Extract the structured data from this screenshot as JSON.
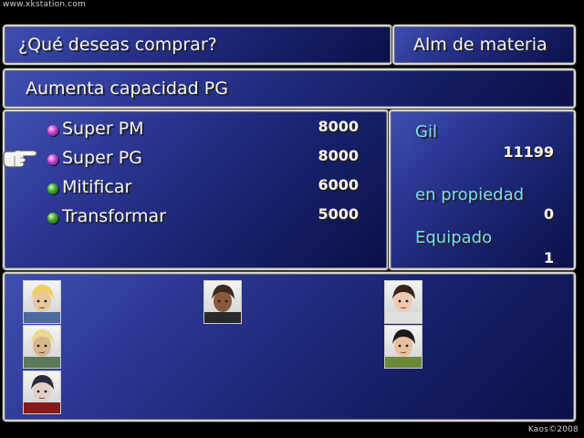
{
  "watermarks": {
    "top": "www.xkstation.com",
    "bottom": "Kaos©2008"
  },
  "header": {
    "prompt": "¿Qué deseas comprar?",
    "shop_name": "Alm de materia"
  },
  "description": "Aumenta capacidad PG",
  "items": [
    {
      "name": "Super PM",
      "price": "8000",
      "orb_color": "purple"
    },
    {
      "name": "Super PG",
      "price": "8000",
      "orb_color": "purple"
    },
    {
      "name": "Mitificar",
      "price": "6000",
      "orb_color": "green"
    },
    {
      "name": "Transformar",
      "price": "5000",
      "orb_color": "green"
    }
  ],
  "selected_index": 1,
  "cursor_icon": "pointing-hand-icon",
  "status": {
    "gil_label": "Gil",
    "gil_value": "11199",
    "owned_label": "en propiedad",
    "owned_value": "0",
    "equipped_label": "Equipado",
    "equipped_value": "1"
  },
  "party": [
    {
      "name": "cloud-portrait"
    },
    {
      "name": "cid-portrait"
    },
    {
      "name": "vincent-portrait"
    },
    {
      "name": "barret-portrait"
    },
    {
      "name": "tifa-portrait"
    },
    {
      "name": "yuffie-portrait"
    }
  ],
  "colors": {
    "panel_light": "#3f4fb0",
    "panel_dark": "#0b1048",
    "label_cyan": "#7ed8ec",
    "text": "#f2f2f2"
  }
}
